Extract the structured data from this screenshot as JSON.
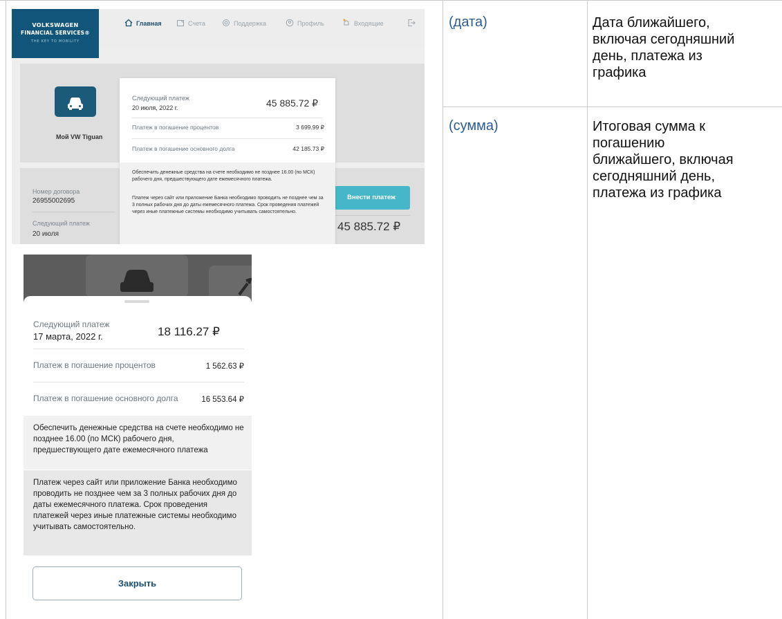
{
  "desktop": {
    "logo": {
      "line1": "VOLKSWAGEN",
      "line2": "FINANCIAL SERVICES®",
      "line3": "THE KEY TO MOBILITY"
    },
    "nav": [
      {
        "label": "Главная",
        "icon": "home-icon"
      },
      {
        "label": "Счета",
        "icon": "accounts-icon"
      },
      {
        "label": "Поддержка",
        "icon": "support-icon"
      },
      {
        "label": "Профиль",
        "icon": "profile-icon"
      },
      {
        "label": "Входящие",
        "icon": "inbox-icon"
      },
      {
        "label": "",
        "icon": "logout-icon"
      }
    ],
    "car_name": "Мой VW Tiguan",
    "contract_label": "Номер договора",
    "contract_number": "26955002695",
    "next_label": "Следующий платеж",
    "next_date_short": "20 июля",
    "pay_button": "Внести платеж",
    "big_amount": "45 885.72 ₽",
    "popup": {
      "title": "Следующий платеж",
      "date": "20 июля, 2022 г.",
      "amount": "45 885.72 ₽",
      "interest_label": "Платеж в погашение процентов",
      "interest_value": "3 699.99 ₽",
      "principal_label": "Платеж в погашение основного долга",
      "principal_value": "42 185.73 ₽",
      "note1": "Обеспечить денежные средства на счете необходимо не позднее 16.00 (по МСК) рабочего дня, предшествующего дате ежемесячного платежа.",
      "note2": "Платеж через сайт или приложение Банка необходимо проводить не позднее чем за 3 полных рабочих дня до даты ежемесячного платежа. Срок проведения платежей через иные платежные системы необходимо учитывать самостоятельно."
    }
  },
  "mobile": {
    "title": "Следующий платеж",
    "date": "17 марта, 2022 г.",
    "amount": "18 116.27 ₽",
    "interest_label": "Платеж в погашение процентов",
    "interest_value": "1 562.63 ₽",
    "principal_label": "Платеж в погашение основного долга",
    "principal_value": "16 553.64 ₽",
    "note1": "Обеспечить денежные средства на счете необходимо не позднее 16.00 (по МСК) рабочего дня, предшествующего дате ежемесячного платежа",
    "note2": "Платеж через сайт или приложение Банка необходимо проводить не позднее чем за 3 полных рабочих дня до даты ежемесячного платежа. Срок проведения платежей через иные платежные системы необходимо учитывать самостоятельно.",
    "close_button": "Закрыть"
  },
  "spec_rows": [
    {
      "key": "(дата)",
      "desc": "Дата ближайшего,\nвключая сегодняшний\nдень, платежа из\nграфика"
    },
    {
      "key": "(сумма)",
      "desc": "Итоговая сумма к\nпогашению\nближайшего, включая\nсегодняшний день,\nплатежа из графика"
    }
  ],
  "colors": {
    "brand": "#11567a",
    "accent": "#46b7c9",
    "link": "#2b5c8f"
  }
}
